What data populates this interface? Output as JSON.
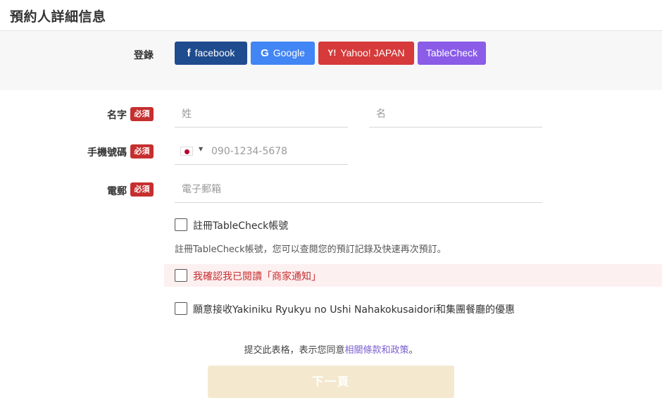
{
  "header": {
    "title": "預約人詳細信息"
  },
  "login": {
    "label": "登錄",
    "buttons": [
      {
        "icon": "facebook-icon",
        "label": "facebook",
        "color": "#1f4b8f"
      },
      {
        "icon": "google-icon",
        "label": "Google",
        "color": "#4285f4"
      },
      {
        "icon": "yahoo-icon",
        "label": "Yahoo! JAPAN",
        "color": "#d63a3a"
      },
      {
        "icon": "",
        "label": "TableCheck",
        "color": "#8a5ce8"
      }
    ]
  },
  "form": {
    "required_badge": "必須",
    "name": {
      "label": "名字",
      "last_placeholder": "姓",
      "first_placeholder": "名"
    },
    "phone": {
      "label": "手機號碼",
      "country_flag": "japan-flag-icon",
      "placeholder": "090-1234-5678"
    },
    "email": {
      "label": "電郵",
      "placeholder": "電子郵箱"
    }
  },
  "options": {
    "register_label": "註冊TableCheck帳號",
    "register_note": "註冊TableCheck帳號，您可以查閱您的預訂記錄及快速再次預訂。",
    "merchant_notice_label": "我確認我已閱讀「商家通知」",
    "promo_label": "願意接收Yakiniku Ryukyu no Ushi Nahakokusaidori和集團餐廳的優惠"
  },
  "terms": {
    "prefix": "提交此表格，表示您同意",
    "link": "相關條款和政策",
    "suffix": "。"
  },
  "submit": {
    "label": "下一頁"
  }
}
